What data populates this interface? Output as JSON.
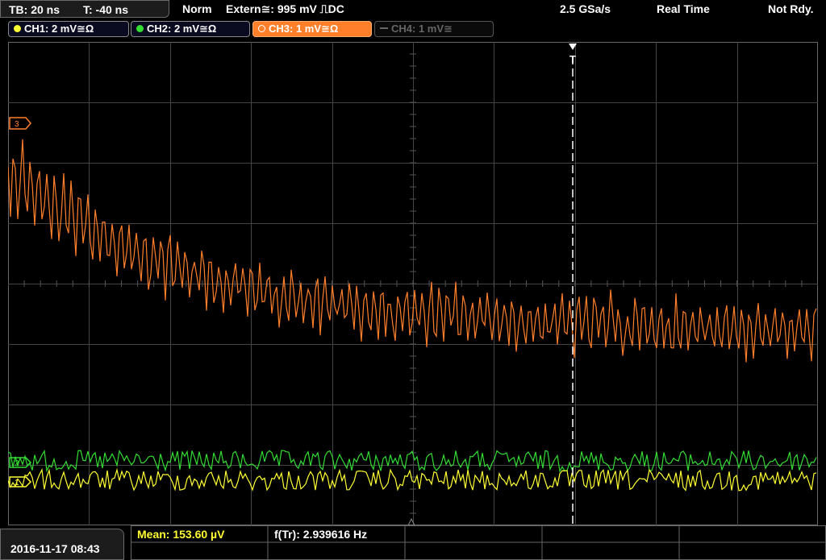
{
  "top_bar": {
    "timebase": "TB: 20 ns",
    "trigger_time": "T: -40 ns",
    "acq_mode": "Norm",
    "trigger_source": "Extern≅: 995 mV ⎍DC",
    "sample_rate": "2.5 GSa/s",
    "acq_type": "Real Time",
    "status": "Not Rdy."
  },
  "channels": [
    {
      "label": "CH1: 2 mV≅Ω",
      "color": "#ffff33",
      "active": false
    },
    {
      "label": "CH2: 2 mV≅Ω",
      "color": "#33dd33",
      "active": false
    },
    {
      "label": "CH3: 1 mV≅Ω",
      "color": "#ff7f2a",
      "active": true
    },
    {
      "label": "CH4: 1 mV≅",
      "color": "#666666",
      "active": false
    }
  ],
  "markers": {
    "trigger": "T",
    "ch1_ref": "1",
    "ch2_ref": "2",
    "ch3_ref": "3"
  },
  "bottom_bar": {
    "datetime": "2016-11-17 08:43",
    "mean": "Mean: 153.60 µV",
    "freq": "f(Tr): 2.939616 Hz"
  },
  "colors": {
    "ch1": "#ffff33",
    "ch2": "#33dd33",
    "ch3": "#ff7f2a",
    "grid": "#555555",
    "measurement": "#ffff33"
  }
}
